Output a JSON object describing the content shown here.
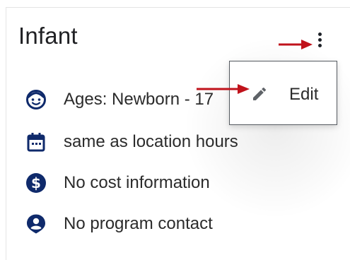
{
  "card": {
    "title": "Infant",
    "details": [
      {
        "icon": "child-face-icon",
        "text": "Ages: Newborn - 17"
      },
      {
        "icon": "calendar-icon",
        "text": "same as location hours"
      },
      {
        "icon": "dollar-icon",
        "text": "No cost information"
      },
      {
        "icon": "person-pin-icon",
        "text": "No program contact"
      }
    ]
  },
  "menu": {
    "edit_label": "Edit",
    "edit_icon": "pencil-icon"
  },
  "colors": {
    "icon": "#0f2a6b",
    "arrow": "#c0121b",
    "text": "#2b2b2b"
  }
}
